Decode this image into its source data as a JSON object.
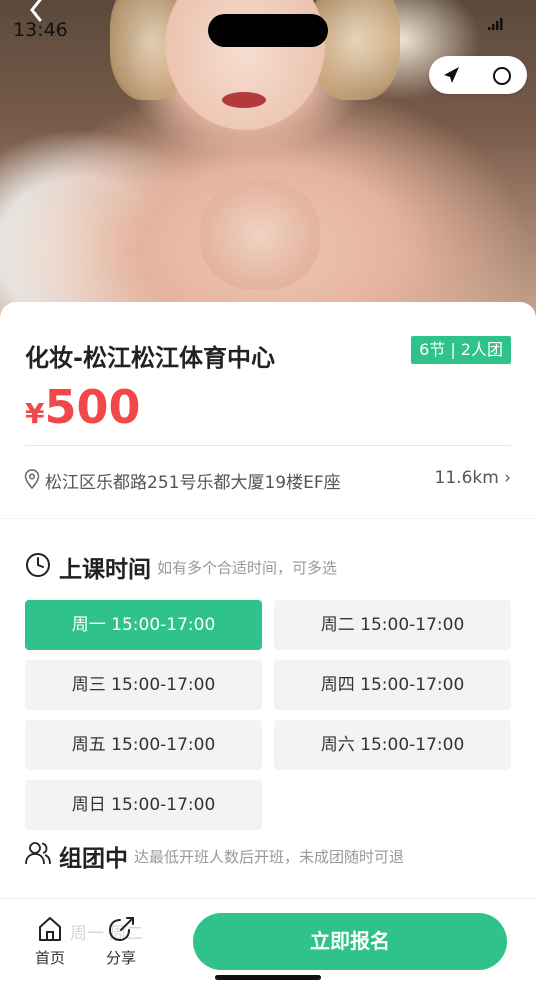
{
  "status_bar": {
    "time": "13:46"
  },
  "course": {
    "title": "化妆-松江松江体育中心",
    "tag": "6节 | 2人团",
    "price_symbol": "¥",
    "price": "500",
    "address": "松江区乐都路251号乐都大厦19楼EF座",
    "distance": "11.6km ›"
  },
  "schedule": {
    "title": "上课时间",
    "subtitle": "如有多个合适时间，可多选",
    "slots": [
      {
        "label": "周一 15:00-17:00",
        "selected": true
      },
      {
        "label": "周二 15:00-17:00",
        "selected": false
      },
      {
        "label": "周三 15:00-17:00",
        "selected": false
      },
      {
        "label": "周四 15:00-17:00",
        "selected": false
      },
      {
        "label": "周五 15:00-17:00",
        "selected": false
      },
      {
        "label": "周六 15:00-17:00",
        "selected": false
      },
      {
        "label": "周日 15:00-17:00",
        "selected": false
      }
    ]
  },
  "group": {
    "title": "组团中",
    "subtitle": "达最低开班人数后开班，未成团随时可退"
  },
  "bottom_bar": {
    "ghost_text": "周一    周二",
    "home_label": "首页",
    "share_label": "分享",
    "cta_label": "立即报名"
  },
  "colors": {
    "accent": "#2fc28a",
    "price": "#f04848"
  },
  "icons": [
    "back-icon",
    "signal-icon",
    "send-icon",
    "location-pin-icon",
    "clock-icon",
    "group-icon",
    "home-icon",
    "share-icon"
  ]
}
